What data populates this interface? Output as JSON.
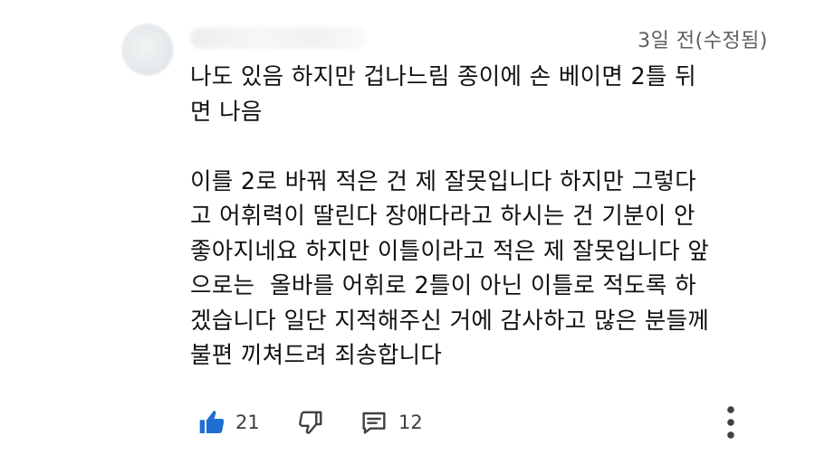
{
  "comment": {
    "timestamp": "3일 전(수정됨)",
    "body_lines": [
      "나도 있음 하지만 겁나느림 종이에 손 베이면 2틀 뒤",
      "면 나음",
      "",
      "이를 2로 바꿔 적은 건 제 잘못입니다 하지만 그렇다",
      "고 어휘력이 딸린다 장애다라고 하시는 건 기분이 안",
      "좋아지네요 하지만 이틀이라고 적은 제 잘못입니다 앞",
      "으로는  올바를 어휘로 2틀이 아닌 이틀로 적도록 하",
      "겠습니다 일단 지적해주신 거에 감사하고 많은 분들께",
      "불편 끼쳐드려 죄송합니다"
    ],
    "like_count": "21",
    "reply_count": "12"
  },
  "icons": {
    "like": "thumbs-up-filled-icon",
    "dislike": "thumbs-down-outline-icon",
    "reply": "comment-reply-icon",
    "more": "vertical-dots-icon"
  },
  "colors": {
    "like_active": "#1f6fd1",
    "icon_gray": "#404040",
    "timestamp": "#606060"
  }
}
